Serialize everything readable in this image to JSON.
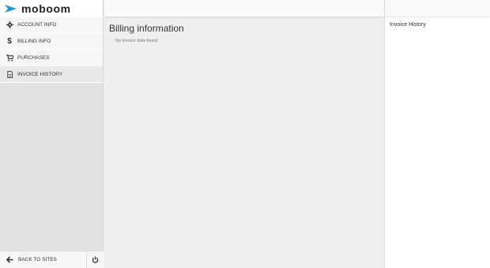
{
  "brand": {
    "name": "moboom",
    "accent": "#1a9ad6"
  },
  "nav": [
    {
      "label": "ACCOUNT INFO",
      "icon": "gear-icon"
    },
    {
      "label": "BILLING INFO",
      "icon": "dollar-icon"
    },
    {
      "label": "PURCHASES",
      "icon": "cart-icon"
    },
    {
      "label": "INVOICE HISTORY",
      "icon": "document-icon"
    }
  ],
  "footer": {
    "back_label": "BACK TO SITES"
  },
  "main": {
    "title": "Billing information",
    "empty_text": "No invoice data found"
  },
  "right": {
    "title": "Invoice History"
  }
}
